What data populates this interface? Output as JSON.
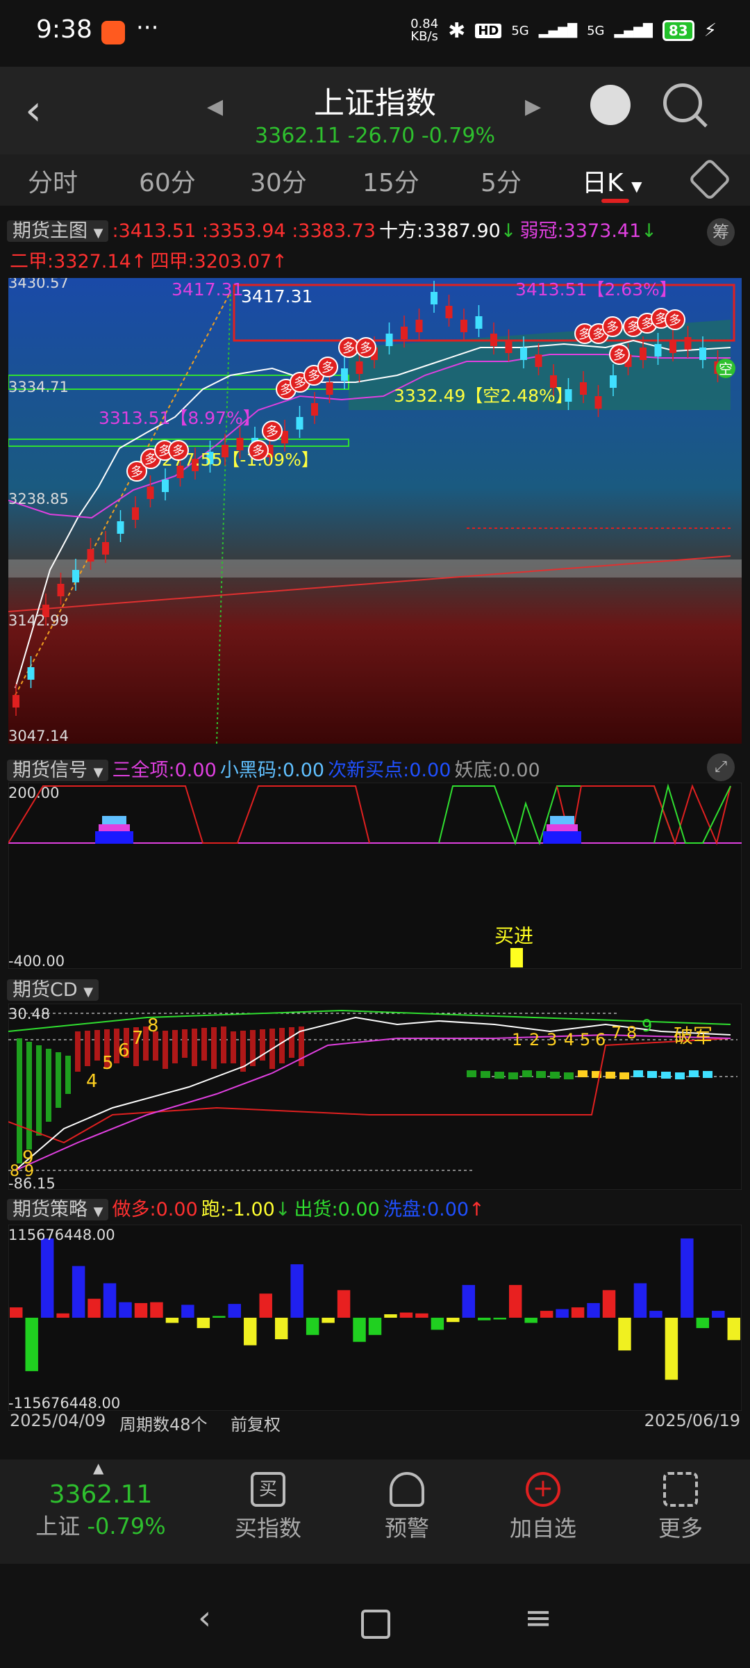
{
  "status": {
    "time": "9:38",
    "net_speed": "0.84\nKB/s",
    "net_speed_top": "0.84",
    "net_speed_bottom": "KB/s",
    "hd": "HD",
    "sig1": "5G",
    "sig2": "5G",
    "battery": "83",
    "dots": "···"
  },
  "header": {
    "title": "上证指数",
    "quote": "3362.11 -26.70 -0.79%",
    "back_icon": "chevron-left-icon"
  },
  "tabs": [
    "分时",
    "60分",
    "30分",
    "15分",
    "5分",
    "日K"
  ],
  "main": {
    "label": "期货主图",
    "values_red": ":3413.51 :3353.94 :3383.73",
    "shifang": "十方:3387.90",
    "shifang_arrow": "↓",
    "ruoguan": "弱冠:3373.41",
    "ruoguan_arrow": "↓",
    "erjia": "二甲:3327.14",
    "erjia_arrow": "↑",
    "sijia": "四甲:3203.07",
    "sijia_arrow": "↑",
    "chip": "筹",
    "axis": [
      "3430.57",
      "3334.71",
      "3238.85",
      "3142.99",
      "3047.14"
    ],
    "ann1": "3417.31",
    "ann1b": "3417.31",
    "ann2": "3413.51【2.63%】",
    "ann3": "3313.51【8.97%】",
    "ann4": "3277.55【-1.09%】",
    "ann5": "3332.49【空2.48%】",
    "kong": "空",
    "duo": "多"
  },
  "signal": {
    "label": "期货信号",
    "i1": "三全项:0.00",
    "i2": "小黑码:0.00",
    "i3": "次新买点:0.00",
    "i4": "妖底:0.00",
    "axis_top": "200.00",
    "axis_bottom": "-400.00",
    "buy": "买进"
  },
  "cd": {
    "label": "期货CD",
    "axis_top": "30.48",
    "axis_bottom": "-86.15",
    "nums_left": [
      "9",
      "8",
      "7",
      "6",
      "5",
      "4"
    ],
    "nums_right": [
      "1",
      "2",
      "3",
      "4",
      "5",
      "6",
      "7",
      "8",
      "9"
    ],
    "pojun": "破军",
    "bottom_nums": "8 9"
  },
  "strategy": {
    "label": "期货策略",
    "i1": "做多:0.00",
    "i2": "跑:-1.00",
    "i2_arrow": "↓",
    "i3": "出货:0.00",
    "i4": "洗盘:0.00",
    "i4_arrow": "↑",
    "axis_top": "115676448.00",
    "axis_bottom": "-115676448.00",
    "bars": [
      {
        "c": "#e82020",
        "v": 0.12
      },
      {
        "c": "#20d020",
        "v": -0.62
      },
      {
        "c": "#2020f0",
        "v": 0.92
      },
      {
        "c": "#e82020",
        "v": 0.05
      },
      {
        "c": "#2020f0",
        "v": 0.6
      },
      {
        "c": "#e82020",
        "v": 0.22
      },
      {
        "c": "#2020f0",
        "v": 0.4
      },
      {
        "c": "#2020f0",
        "v": 0.18
      },
      {
        "c": "#e82020",
        "v": 0.17
      },
      {
        "c": "#e82020",
        "v": 0.18
      },
      {
        "c": "#f0f020",
        "v": -0.06
      },
      {
        "c": "#2020f0",
        "v": 0.15
      },
      {
        "c": "#f0f020",
        "v": -0.12
      },
      {
        "c": "#20d020",
        "v": 0.02
      },
      {
        "c": "#2020f0",
        "v": 0.16
      },
      {
        "c": "#f0f020",
        "v": -0.32
      },
      {
        "c": "#e82020",
        "v": 0.28
      },
      {
        "c": "#f0f020",
        "v": -0.25
      },
      {
        "c": "#2020f0",
        "v": 0.62
      },
      {
        "c": "#20d020",
        "v": -0.2
      },
      {
        "c": "#f0f020",
        "v": -0.06
      },
      {
        "c": "#e82020",
        "v": 0.32
      },
      {
        "c": "#20d020",
        "v": -0.28
      },
      {
        "c": "#20d020",
        "v": -0.2
      },
      {
        "c": "#f0f020",
        "v": 0.04
      },
      {
        "c": "#e82020",
        "v": 0.06
      },
      {
        "c": "#e82020",
        "v": 0.05
      },
      {
        "c": "#20d020",
        "v": -0.14
      },
      {
        "c": "#f0f020",
        "v": -0.05
      },
      {
        "c": "#2020f0",
        "v": 0.38
      },
      {
        "c": "#20d020",
        "v": -0.03
      },
      {
        "c": "#20d020",
        "v": -0.02
      },
      {
        "c": "#e82020",
        "v": 0.38
      },
      {
        "c": "#20d020",
        "v": -0.06
      },
      {
        "c": "#e82020",
        "v": 0.08
      },
      {
        "c": "#2020f0",
        "v": 0.1
      },
      {
        "c": "#e82020",
        "v": 0.12
      },
      {
        "c": "#2020f0",
        "v": 0.17
      },
      {
        "c": "#e82020",
        "v": 0.32
      },
      {
        "c": "#f0f020",
        "v": -0.38
      },
      {
        "c": "#2020f0",
        "v": 0.4
      },
      {
        "c": "#2020f0",
        "v": 0.08
      },
      {
        "c": "#f0f020",
        "v": -0.72
      },
      {
        "c": "#2020f0",
        "v": 0.92
      },
      {
        "c": "#20d020",
        "v": -0.12
      },
      {
        "c": "#2020f0",
        "v": 0.08
      },
      {
        "c": "#f0f020",
        "v": -0.26
      }
    ]
  },
  "dates": {
    "start": "2025/04/09",
    "count": "周期数48个",
    "adj": "前复权",
    "end": "2025/06/19"
  },
  "bottom": {
    "price": "3362.11",
    "name": "上证",
    "pct": "-0.79%",
    "items": [
      "买指数",
      "预警",
      "加自选",
      "更多"
    ],
    "icons": [
      "buy-icon",
      "bell-icon",
      "add-circle-icon",
      "grid-icon"
    ],
    "buy_char": "买"
  }
}
